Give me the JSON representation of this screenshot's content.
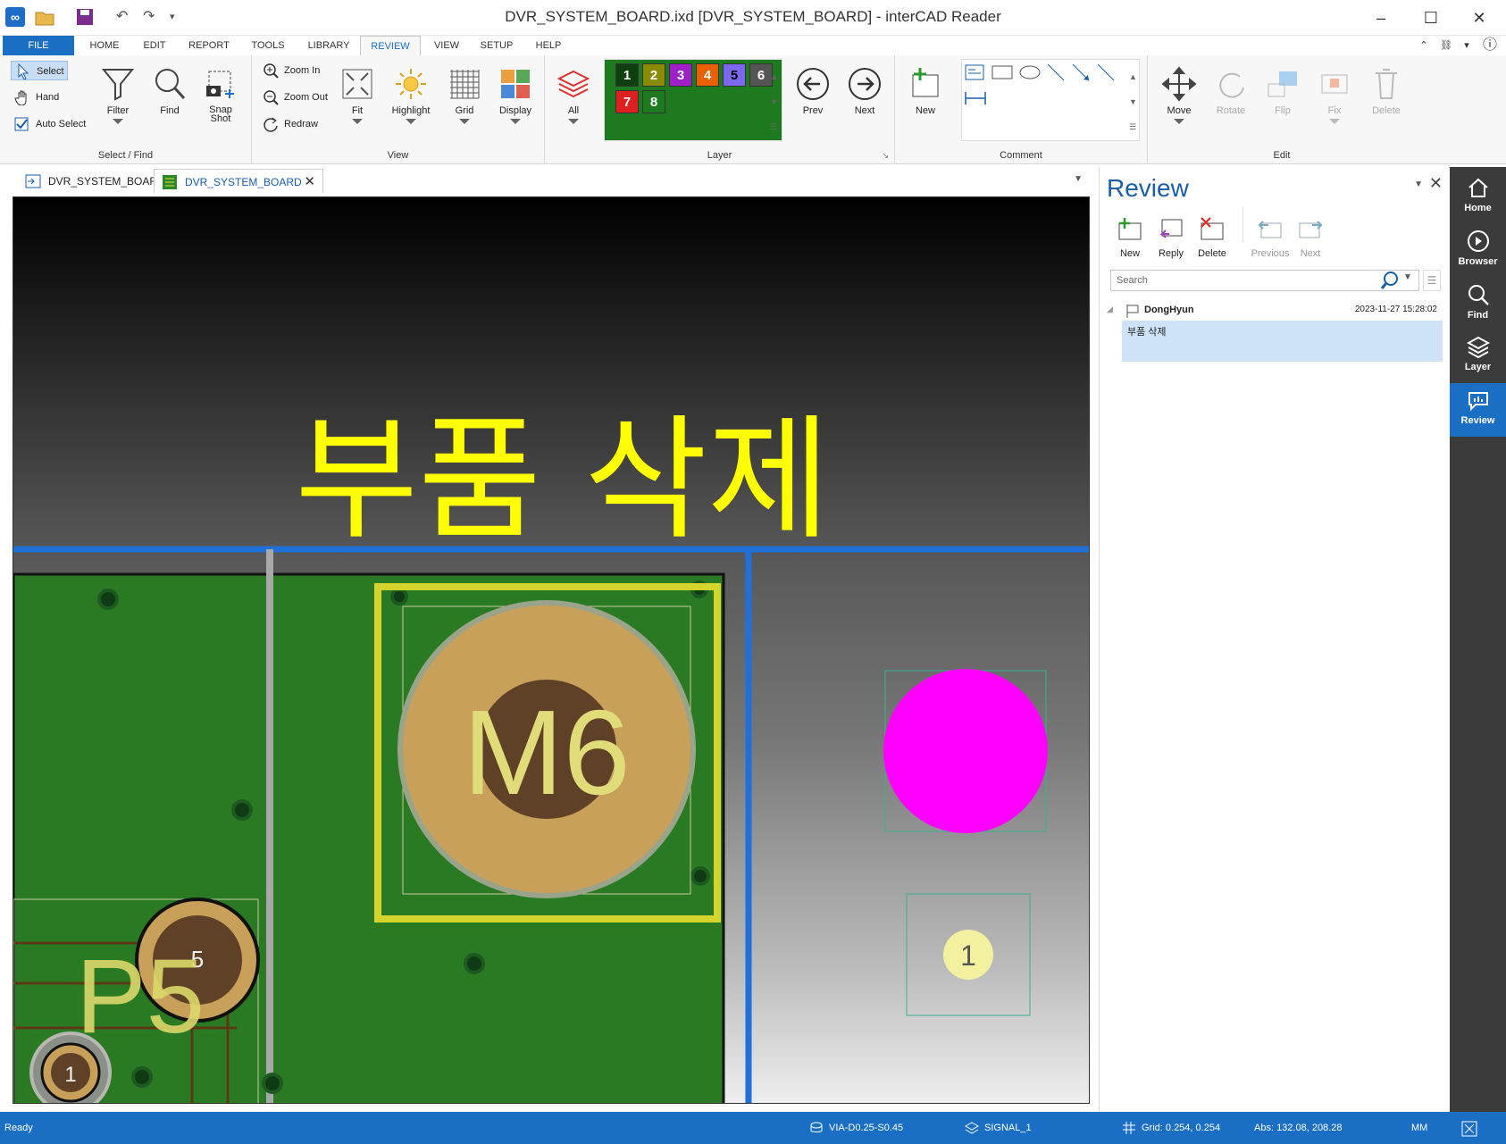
{
  "window": {
    "title": "DVR_SYSTEM_BOARD.ixd [DVR_SYSTEM_BOARD] - interCAD Reader"
  },
  "menu": [
    "FILE",
    "HOME",
    "EDIT",
    "REPORT",
    "TOOLS",
    "LIBRARY",
    "REVIEW",
    "VIEW",
    "SETUP",
    "HELP"
  ],
  "ribbon": {
    "select_find": {
      "label": "Select / Find",
      "select": "Select",
      "hand": "Hand",
      "auto_select": "Auto Select",
      "filter": "Filter",
      "find": "Find",
      "snapshot_line1": "Snap",
      "snapshot_line2": "Shot"
    },
    "view": {
      "label": "View",
      "zoom_in": "Zoom In",
      "zoom_out": "Zoom Out",
      "redraw": "Redraw",
      "fit": "Fit",
      "highlight": "Highlight",
      "grid": "Grid",
      "display": "Display"
    },
    "layer": {
      "label": "Layer",
      "all": "All",
      "chips": [
        {
          "n": "1",
          "c": "#1e7a1e"
        },
        {
          "n": "2",
          "c": "#0f3f0f"
        },
        {
          "n": "3",
          "c": "#8a8a00"
        },
        {
          "n": "4",
          "c": "#a020c8"
        },
        {
          "n": "5",
          "c": "#e86000"
        },
        {
          "n": "6",
          "c": "#7b68ee"
        },
        {
          "n": "7",
          "c": "#555555"
        },
        {
          "n": "8",
          "c": "#e02020"
        }
      ],
      "prev": "Prev",
      "next": "Next"
    },
    "comment": {
      "label": "Comment",
      "new": "New"
    },
    "edit": {
      "label": "Edit",
      "move": "Move",
      "rotate": "Rotate",
      "flip": "Flip",
      "fix": "Fix",
      "delete": "Delete"
    }
  },
  "doc_tabs": [
    {
      "label": "DVR_SYSTEM_BOARD"
    },
    {
      "label": "DVR_SYSTEM_BOARD"
    }
  ],
  "canvas": {
    "annotation": "부품 삭제",
    "m6": "M6",
    "p5": "P5",
    "pin5": "5",
    "pin1": "1",
    "pad1": "1"
  },
  "review": {
    "title": "Review",
    "new": "New",
    "reply": "Reply",
    "delete": "Delete",
    "previous": "Previous",
    "next": "Next",
    "search_placeholder": "Search",
    "comment": {
      "author": "DongHyun",
      "time": "2023-11-27 15:28:02",
      "text": "부품 삭제"
    }
  },
  "sidenav": [
    "Home",
    "Browser",
    "Find",
    "Layer",
    "Review"
  ],
  "status": {
    "ready": "Ready",
    "via": "VIA-D0.25-S0.45",
    "layer": "SIGNAL_1",
    "grid": "Grid: 0.254, 0.254",
    "abs": "Abs: 132.08, 208.28",
    "units": "MM"
  }
}
